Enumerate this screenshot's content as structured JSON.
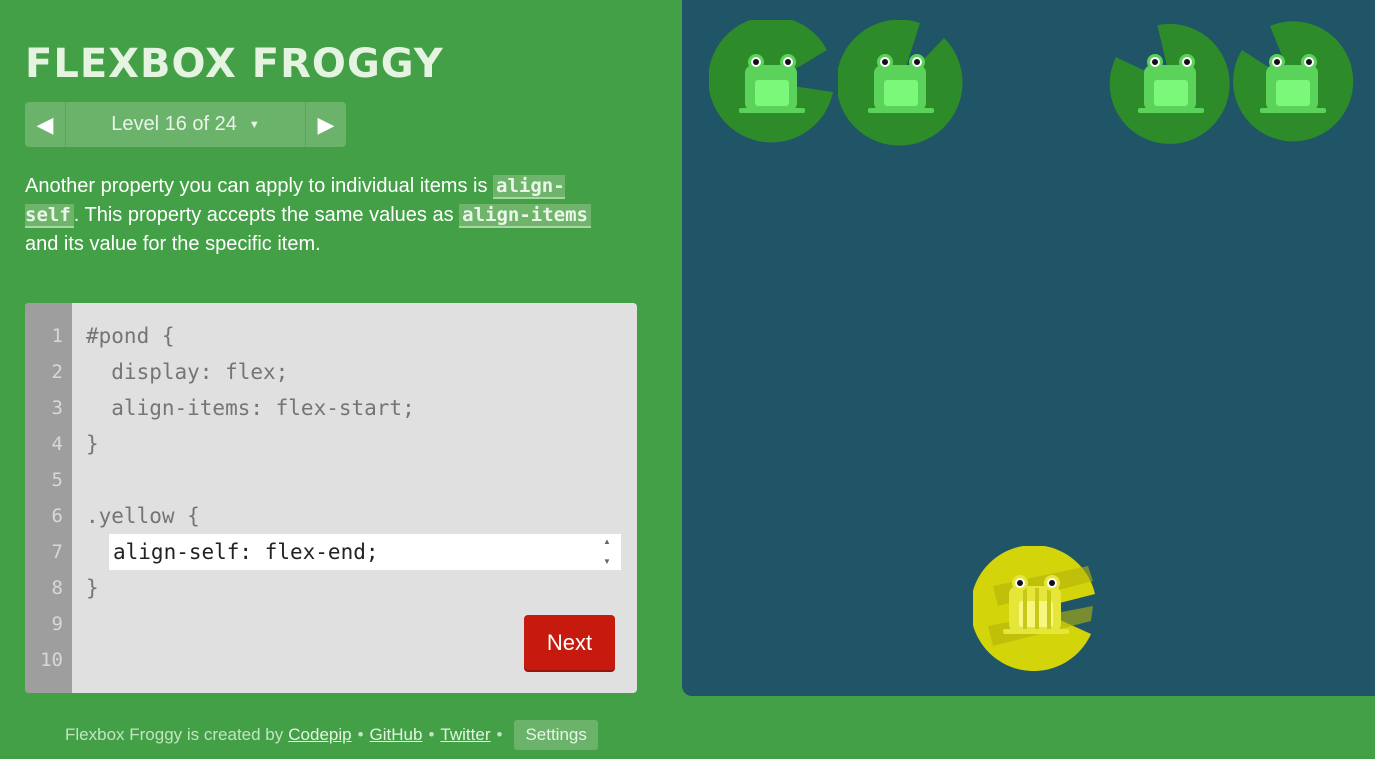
{
  "app": {
    "title": "FLEXBOX FROGGY"
  },
  "level_nav": {
    "label": "Level 16 of 24",
    "prev_icon": "triangle-left",
    "next_icon": "triangle-right",
    "caret_icon": "triangle-down"
  },
  "instructions": {
    "part1": "Another property you can apply to individual items is ",
    "code1": "align-self",
    "part2": ". This property accepts the same values as ",
    "code2": "align-items",
    "part3": " and its value for the specific item."
  },
  "editor": {
    "line_numbers": [
      "1",
      "2",
      "3",
      "4",
      "5",
      "6",
      "7",
      "8",
      "9",
      "10"
    ],
    "lines": [
      "#pond {",
      "  display: flex;",
      "  align-items: flex-start;",
      "}",
      "",
      ".yellow {",
      "",
      "}"
    ],
    "input_value": "align-self: flex-end;",
    "next_label": "Next"
  },
  "pond": {
    "colors": {
      "water": "#1f5566",
      "green_pad": "#2e8b2a",
      "green_frog": "#5bd35a",
      "yellow_pad": "#d4d40a",
      "yellow_frog": "#f1f160"
    },
    "frogs": [
      {
        "color": "green",
        "name": "frog-green-1"
      },
      {
        "color": "green",
        "name": "frog-green-2"
      },
      {
        "color": "yellow",
        "name": "frog-yellow"
      },
      {
        "color": "green",
        "name": "frog-green-3"
      },
      {
        "color": "green",
        "name": "frog-green-4"
      }
    ]
  },
  "footer": {
    "credit_text": "Flexbox Froggy is created by",
    "codepip_link": "Codepip",
    "github_link": "GitHub",
    "twitter_link": "Twitter",
    "separator": "•",
    "settings_label": "Settings"
  }
}
